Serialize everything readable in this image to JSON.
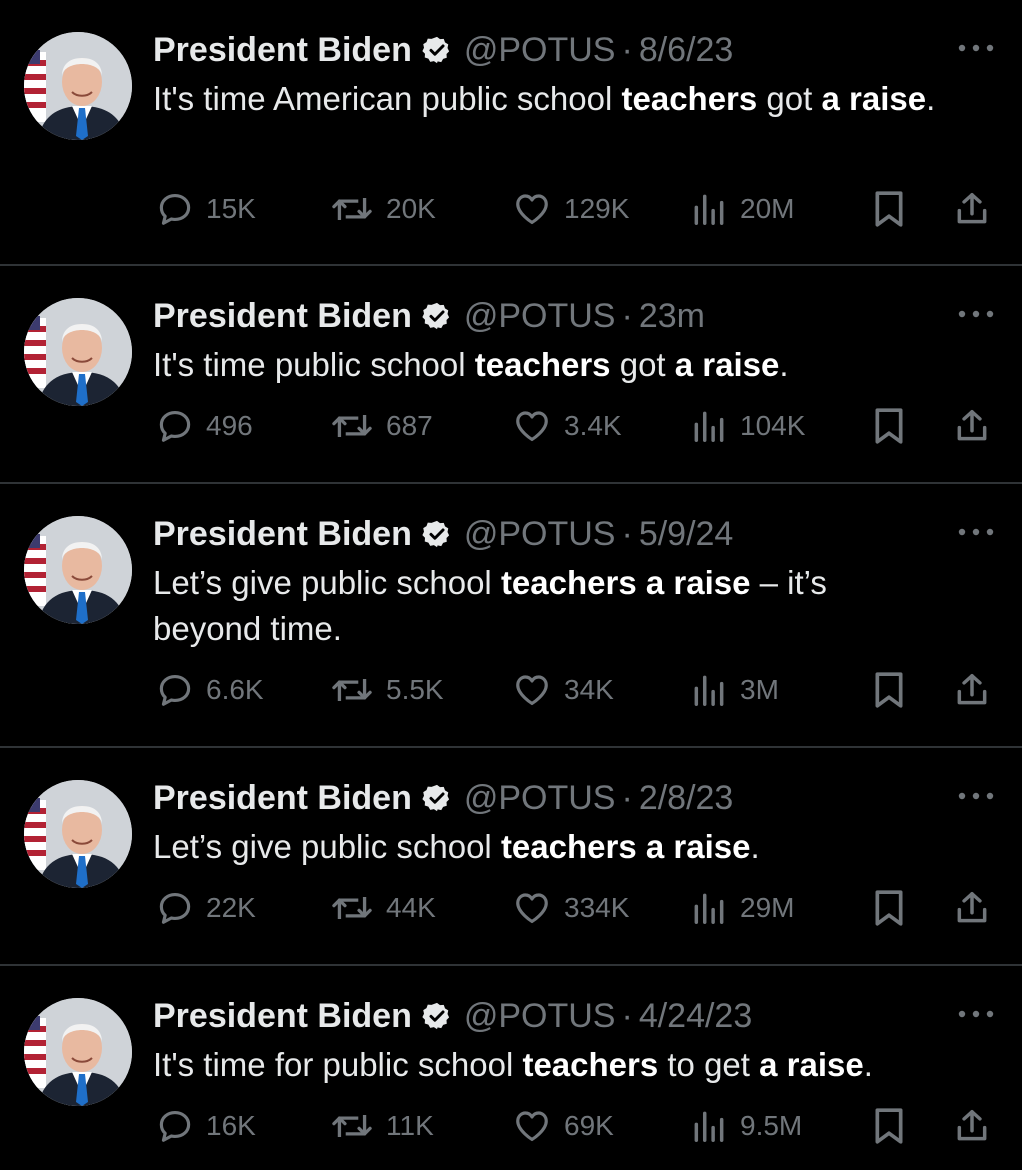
{
  "colors": {
    "background": "#000000",
    "text": "#e7e9ea",
    "muted": "#71767b",
    "divider": "#2f3336",
    "verified": "#e7e9ea"
  },
  "tweets": [
    {
      "name": "President Biden",
      "handle": "@POTUS",
      "separator": "·",
      "time": "8/6/23",
      "text_segments": [
        {
          "text": "It's time American public school ",
          "bold": false
        },
        {
          "text": "teachers",
          "bold": true
        },
        {
          "text": " got ",
          "bold": false
        },
        {
          "text": "a raise",
          "bold": true
        },
        {
          "text": ".",
          "bold": false
        }
      ],
      "replies": "15K",
      "reposts": "20K",
      "likes": "129K",
      "views": "20M"
    },
    {
      "name": "President Biden",
      "handle": "@POTUS",
      "separator": "·",
      "time": "23m",
      "text_segments": [
        {
          "text": "It's time public school ",
          "bold": false
        },
        {
          "text": "teachers",
          "bold": true
        },
        {
          "text": " got ",
          "bold": false
        },
        {
          "text": "a raise",
          "bold": true
        },
        {
          "text": ".",
          "bold": false
        }
      ],
      "replies": "496",
      "reposts": "687",
      "likes": "3.4K",
      "views": "104K"
    },
    {
      "name": "President Biden",
      "handle": "@POTUS",
      "separator": "·",
      "time": "5/9/24",
      "text_segments": [
        {
          "text": "Let’s give public school ",
          "bold": false
        },
        {
          "text": "teachers a raise",
          "bold": true
        },
        {
          "text": " – it’s beyond time.",
          "bold": false
        }
      ],
      "replies": "6.6K",
      "reposts": "5.5K",
      "likes": "34K",
      "views": "3M"
    },
    {
      "name": "President Biden",
      "handle": "@POTUS",
      "separator": "·",
      "time": "2/8/23",
      "text_segments": [
        {
          "text": "Let’s give public school ",
          "bold": false
        },
        {
          "text": "teachers a raise",
          "bold": true
        },
        {
          "text": ".",
          "bold": false
        }
      ],
      "replies": "22K",
      "reposts": "44K",
      "likes": "334K",
      "views": "29M"
    },
    {
      "name": "President Biden",
      "handle": "@POTUS",
      "separator": "·",
      "time": "4/24/23",
      "text_segments": [
        {
          "text": "It's time for public school ",
          "bold": false
        },
        {
          "text": "teachers",
          "bold": true
        },
        {
          "text": " to get ",
          "bold": false
        },
        {
          "text": "a raise",
          "bold": true
        },
        {
          "text": ".",
          "bold": false
        }
      ],
      "replies": "16K",
      "reposts": "11K",
      "likes": "69K",
      "views": "9.5M"
    }
  ],
  "icons": {
    "verified": "verified-badge-icon",
    "more": "more-dots-icon",
    "reply": "reply-bubble-icon",
    "repost": "repost-arrows-icon",
    "like": "heart-icon",
    "views": "bar-chart-icon",
    "bookmark": "bookmark-icon",
    "share": "share-upload-icon"
  }
}
